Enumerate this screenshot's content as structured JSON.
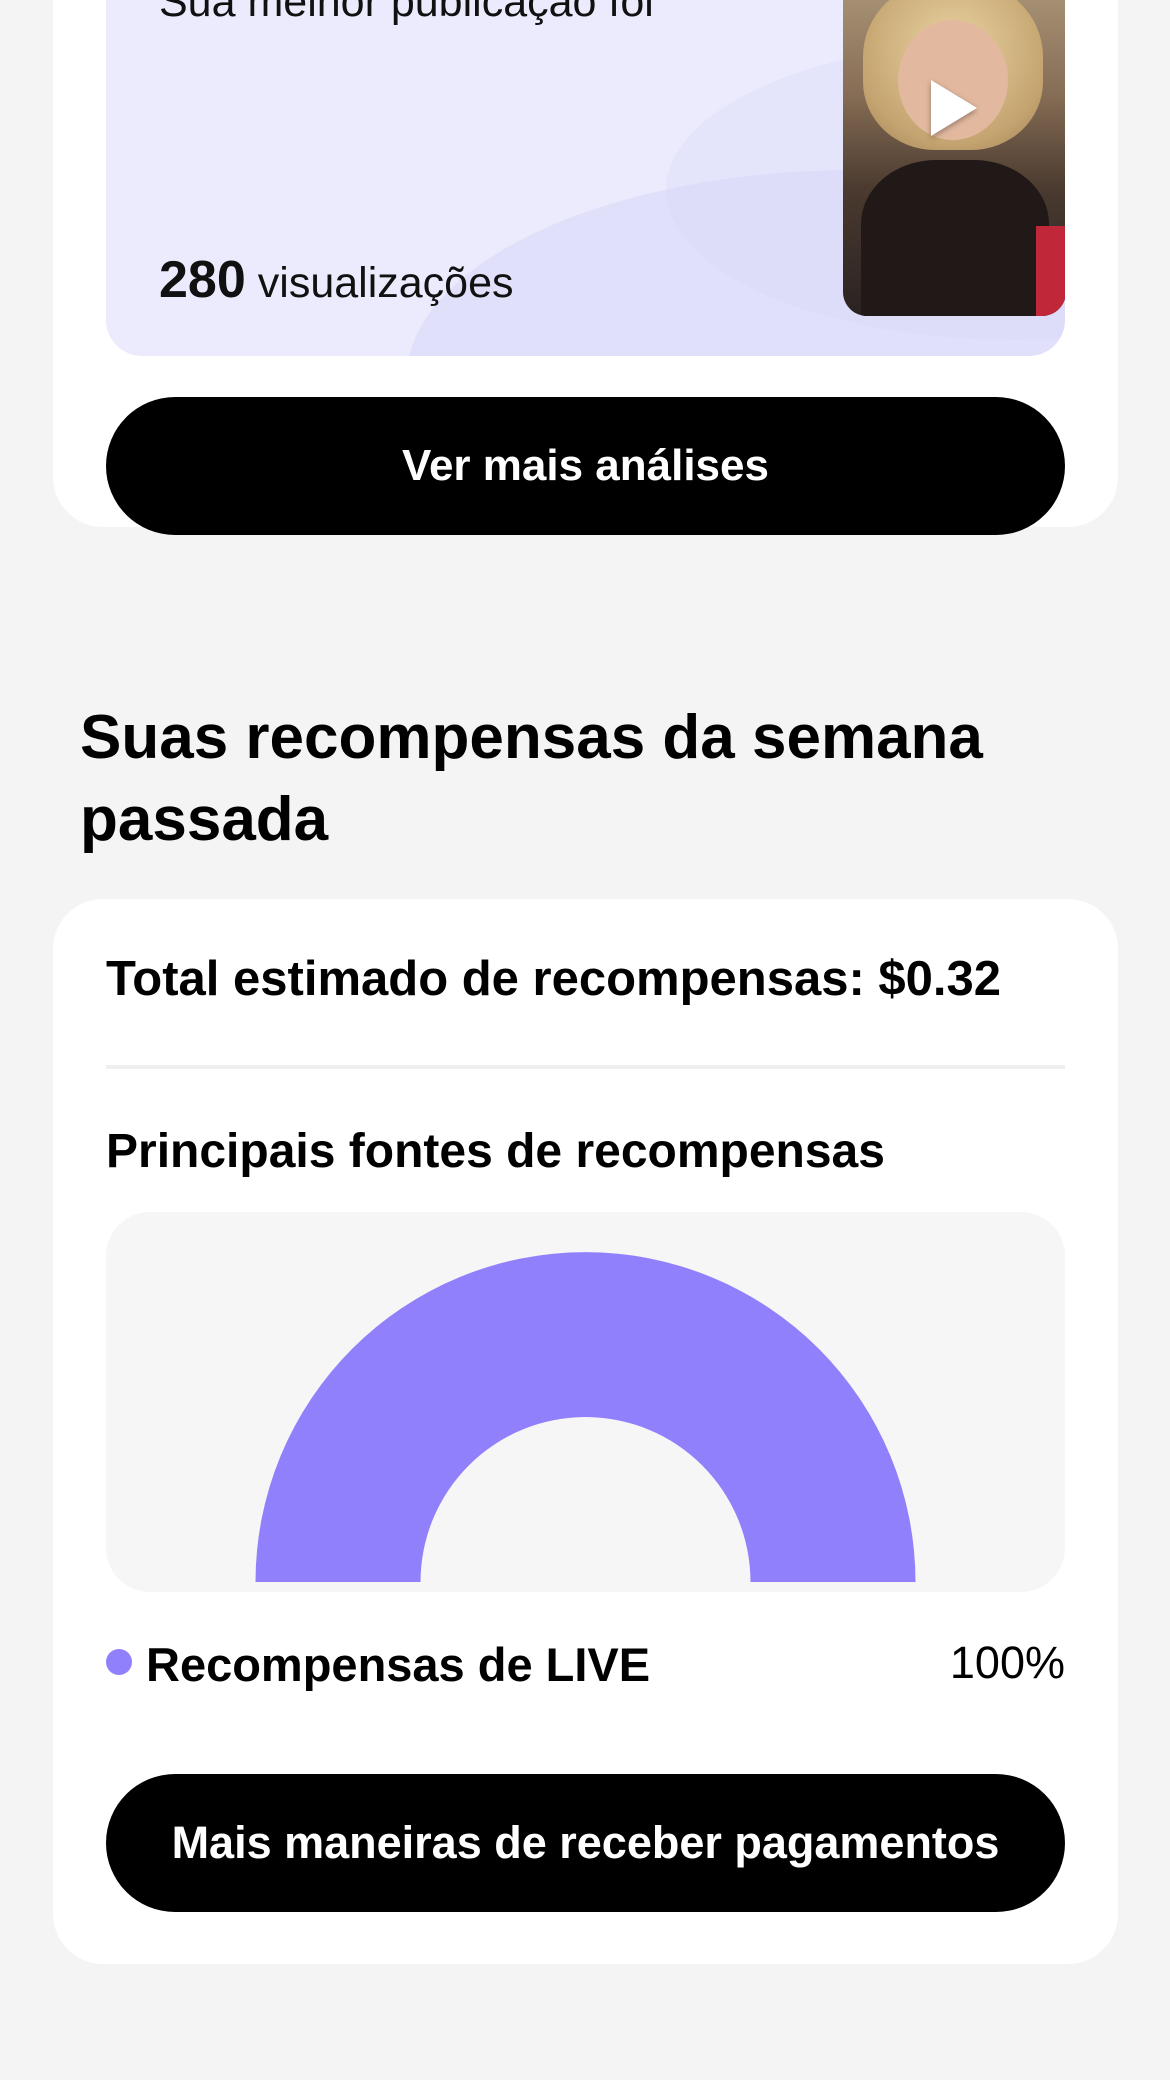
{
  "analytics_card": {
    "best_post_text": "Sua melhor publicação foi",
    "views_count": "280",
    "views_label": "visualizações",
    "thumbnail": {
      "icon": "play-icon"
    },
    "more_analytics_label": "Ver mais análises"
  },
  "rewards": {
    "section_title": "Suas recompensas da semana passada",
    "total_label": "Total estimado de recompensas: $0.32",
    "sources_title": "Principais fontes de recompensas",
    "legend": [
      {
        "label": "Recompensas de LIVE",
        "value": "100%",
        "color": "#9180fb"
      }
    ],
    "more_ways_label": "Mais maneiras de receber pagamentos"
  },
  "chart_data": {
    "type": "pie",
    "style": "semicircle-donut",
    "categories": [
      "Recompensas de LIVE"
    ],
    "values": [
      100
    ],
    "unit": "%",
    "colors": [
      "#9180fb"
    ]
  },
  "colors": {
    "background": "#f4f4f5",
    "card": "#ffffff",
    "button": "#000000",
    "accent": "#9180fb",
    "best_post_background": "#ebebfd"
  }
}
